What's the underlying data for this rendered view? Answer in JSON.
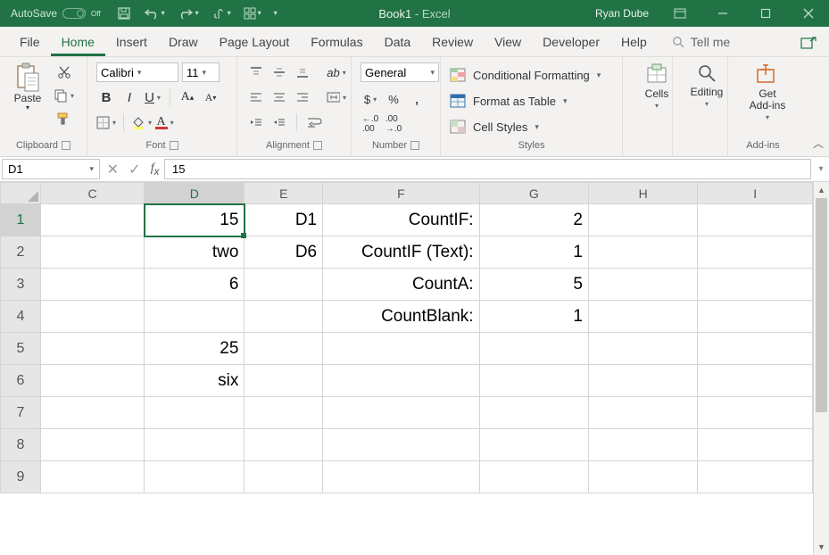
{
  "titlebar": {
    "autosave_label": "AutoSave",
    "autosave_state": "Off",
    "doc_name": "Book1",
    "app_sep": "  -  ",
    "app_name": "Excel",
    "user": "Ryan Dube"
  },
  "tabs": {
    "file": "File",
    "home": "Home",
    "insert": "Insert",
    "draw": "Draw",
    "page_layout": "Page Layout",
    "formulas": "Formulas",
    "data": "Data",
    "review": "Review",
    "view": "View",
    "developer": "Developer",
    "help": "Help",
    "tell_me": "Tell me"
  },
  "ribbon": {
    "clipboard": {
      "paste": "Paste",
      "label": "Clipboard"
    },
    "font": {
      "name": "Calibri",
      "size": "11",
      "label": "Font"
    },
    "alignment": {
      "label": "Alignment"
    },
    "number": {
      "format": "General",
      "label": "Number"
    },
    "styles": {
      "cond": "Conditional Formatting",
      "table": "Format as Table",
      "cell": "Cell Styles",
      "label": "Styles"
    },
    "cells": {
      "label": "Cells",
      "btn": "Cells"
    },
    "editing": {
      "label": "Editing",
      "btn": "Editing"
    },
    "addins": {
      "label": "Add-ins",
      "btn": "Get\nAdd-ins"
    }
  },
  "namebox": "D1",
  "formula": "15",
  "columns": [
    "C",
    "D",
    "E",
    "F",
    "G",
    "H",
    "I"
  ],
  "rows": [
    "1",
    "2",
    "3",
    "4",
    "5",
    "6",
    "7",
    "8",
    "9"
  ],
  "cells": {
    "D1": "15",
    "E1": "D1",
    "F1": "CountIF:",
    "G1": "2",
    "D2": "two",
    "E2": "D6",
    "F2": "CountIF (Text):",
    "G2": "1",
    "D3": "6",
    "F3": "CountA:",
    "G3": "5",
    "F4": "CountBlank:",
    "G4": "1",
    "D5": "25",
    "D6": "six"
  }
}
